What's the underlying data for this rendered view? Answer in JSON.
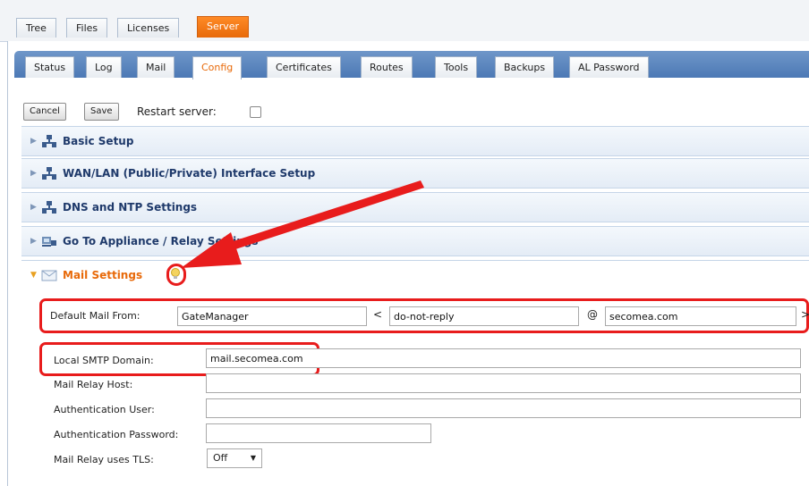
{
  "top_tabs": [
    {
      "label": "Tree"
    },
    {
      "label": "Files"
    },
    {
      "label": "Licenses"
    },
    {
      "label": "Server",
      "active": true
    }
  ],
  "sub_tabs": [
    {
      "label": "Status"
    },
    {
      "label": "Log"
    },
    {
      "label": "Mail"
    },
    {
      "label": "Config",
      "active": true
    },
    {
      "label": "Certificates"
    },
    {
      "label": "Routes"
    },
    {
      "label": "Tools"
    },
    {
      "label": "Backups"
    },
    {
      "label": "AL Password"
    }
  ],
  "toolbar": {
    "cancel_label": "Cancel",
    "save_label": "Save",
    "restart_label": "Restart server:",
    "restart_checked": false
  },
  "sections": [
    {
      "label": "Basic Setup",
      "icon": "network-icon"
    },
    {
      "label": "WAN/LAN (Public/Private) Interface Setup",
      "icon": "network-icon"
    },
    {
      "label": "DNS and NTP Settings",
      "icon": "network-icon"
    },
    {
      "label": "Go To Appliance / Relay Settings",
      "icon": "appliance-icon"
    },
    {
      "label": "Mail Settings",
      "icon": "mail-icon",
      "open": true
    }
  ],
  "mail": {
    "from_label": "Default Mail From:",
    "from_name": "GateManager",
    "lt": "<",
    "from_user": "do-not-reply",
    "at": "@",
    "from_domain": "secomea.com",
    "gt": ">",
    "smtp_domain_label": "Local SMTP Domain:",
    "smtp_domain": "mail.secomea.com",
    "relay_host_label": "Mail Relay Host:",
    "relay_host": "",
    "auth_user_label": "Authentication User:",
    "auth_user": "",
    "auth_password_label": "Authentication Password:",
    "auth_password": "",
    "tls_label": "Mail Relay uses TLS:",
    "tls_value": "Off"
  },
  "colors": {
    "accent": "#e86a0a",
    "annotation": "#e81c1c",
    "tabbar": "#4c79b5"
  }
}
